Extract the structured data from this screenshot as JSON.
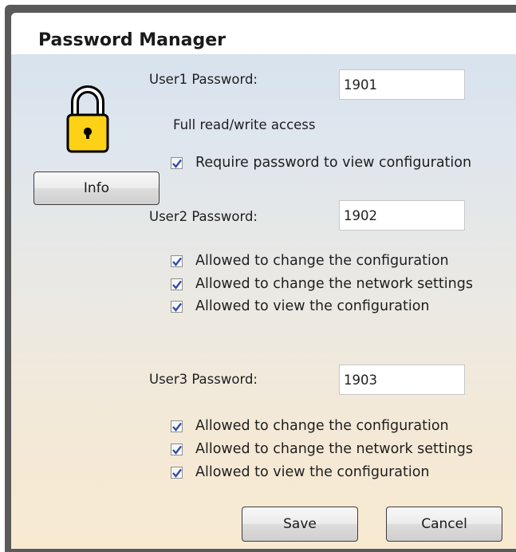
{
  "window": {
    "title": "Password Manager"
  },
  "sidebar": {
    "icon": "padlock-icon",
    "info_button_label": "Info"
  },
  "user1": {
    "password_label": "User1 Password:",
    "password_value": "1901",
    "access_description": "Full read/write access",
    "options": [
      {
        "label": "Require password to view configuration",
        "checked": true
      }
    ]
  },
  "user2": {
    "password_label": "User2 Password:",
    "password_value": "1902",
    "options": [
      {
        "label": "Allowed to change the configuration",
        "checked": true
      },
      {
        "label": "Allowed to change the network settings",
        "checked": true
      },
      {
        "label": "Allowed to view the configuration",
        "checked": true
      }
    ]
  },
  "user3": {
    "password_label": "User3 Password:",
    "password_value": "1903",
    "options": [
      {
        "label": "Allowed to change the configuration",
        "checked": true
      },
      {
        "label": "Allowed to change the network settings",
        "checked": true
      },
      {
        "label": "Allowed to view the configuration",
        "checked": true
      }
    ]
  },
  "footer": {
    "save_label": "Save",
    "cancel_label": "Cancel"
  },
  "colors": {
    "lock_body": "#fcd116",
    "lock_outline": "#000000",
    "checkmark": "#2e4fa3"
  }
}
